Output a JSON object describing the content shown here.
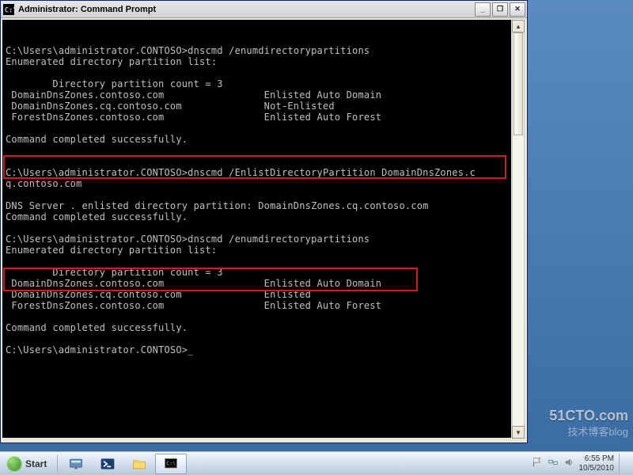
{
  "window": {
    "title": "Administrator: Command Prompt"
  },
  "console": {
    "prompt": "C:\\Users\\administrator.CONTOSO>",
    "cmd1": "dnscmd /enumdirectorypartitions",
    "enum_header": "Enumerated directory partition list:",
    "count_line": "        Directory partition count = 3",
    "part_a1": " DomainDnsZones.contoso.com                 Enlisted Auto Domain",
    "part_a2": " DomainDnsZones.cq.contoso.com              Not-Enlisted",
    "part_a3": " ForestDnsZones.contoso.com                 Enlisted Auto Forest",
    "done": "Command completed successfully.",
    "blank": "",
    "cmd2a": "dnscmd /EnlistDirectoryPartition DomainDnsZones.c",
    "cmd2b": "q.contoso.com",
    "enlist_result": "DNS Server . enlisted directory partition: DomainDnsZones.cq.contoso.com",
    "cmd3": "dnscmd /enumdirectorypartitions",
    "part_b1": " DomainDnsZones.contoso.com                 Enlisted Auto Domain",
    "part_b2": " DomainDnsZones.cq.contoso.com              Enlisted",
    "part_b3": " ForestDnsZones.contoso.com                 Enlisted Auto Forest"
  },
  "taskbar": {
    "start": "Start"
  },
  "tray": {
    "time": "6:55 PM",
    "date": "10/5/2010"
  },
  "watermark": "51CTO.com",
  "watermark2": "技术博客blog"
}
